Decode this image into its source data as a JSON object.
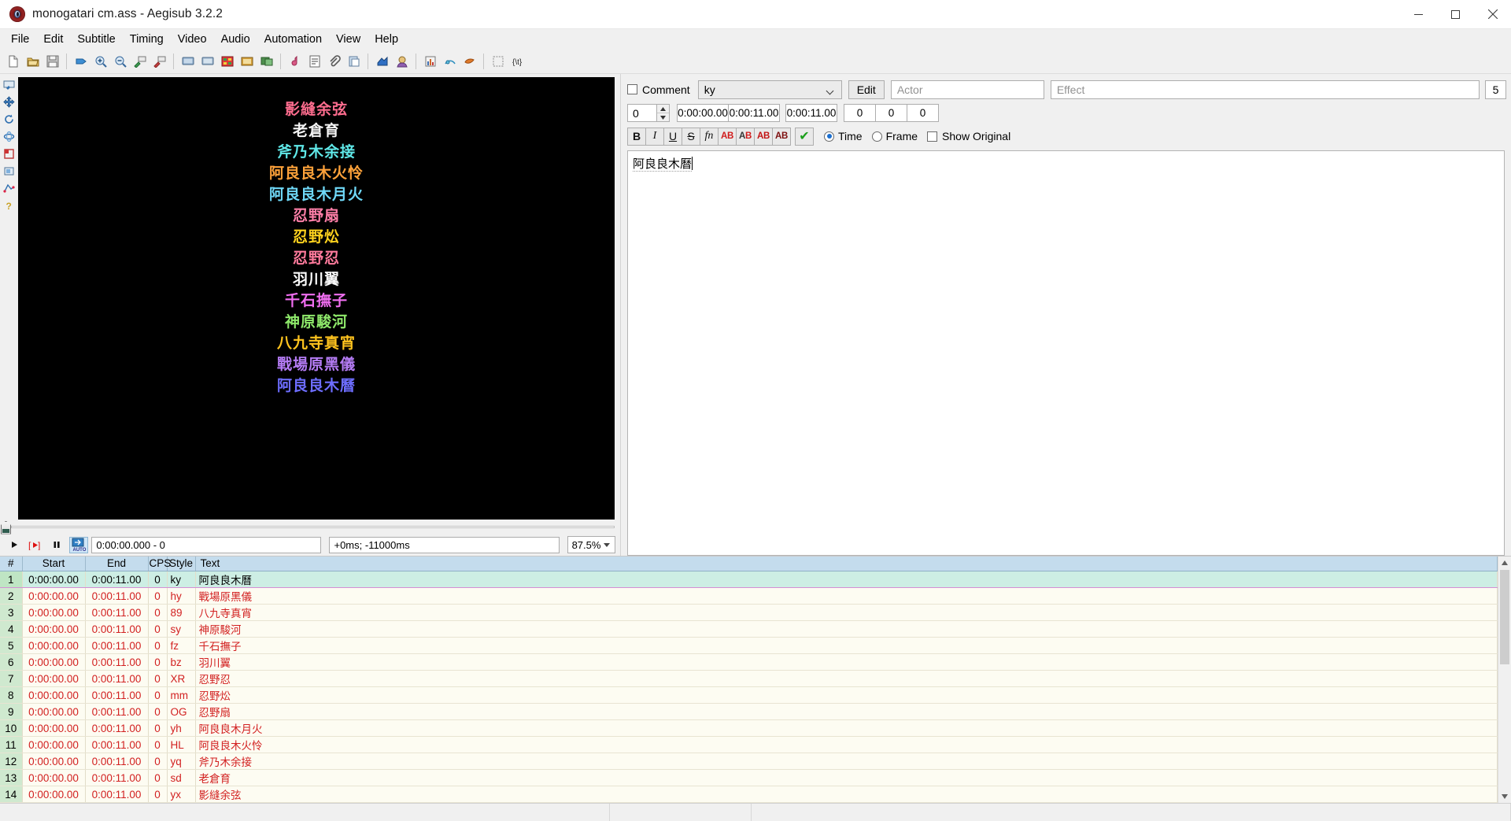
{
  "window": {
    "title": "monogatari cm.ass - Aegisub 3.2.2",
    "app_icon": "aegisub-icon",
    "minimize_label": "Minimize",
    "maximize_label": "Maximize",
    "close_label": "Close"
  },
  "menubar": {
    "items": [
      {
        "label": "File"
      },
      {
        "label": "Edit"
      },
      {
        "label": "Subtitle"
      },
      {
        "label": "Timing"
      },
      {
        "label": "Video"
      },
      {
        "label": "Audio"
      },
      {
        "label": "Automation"
      },
      {
        "label": "View"
      },
      {
        "label": "Help"
      }
    ]
  },
  "toolbar": {
    "groups": [
      [
        "new-subtitles-icon",
        "open-subtitles-icon",
        "save-subtitles-icon"
      ],
      [
        "jump-to-icon",
        "zoom-in-icon",
        "zoom-out-icon",
        "set-start-to-video-icon",
        "set-end-to-video-icon"
      ],
      [
        "open-video-icon",
        "close-video-icon",
        "open-keyframes-icon",
        "open-timecodes-icon",
        "open-video-detached-icon"
      ],
      [
        "open-audio-icon",
        "spellcheck-icon",
        "attachments-icon",
        "paste-over-icon"
      ],
      [
        "shift-times-icon",
        "styles-manager-icon"
      ],
      [
        "properties-icon",
        "resample-icon",
        "fonts-collector-icon"
      ],
      [
        "select-lines-icon",
        "tags-icon"
      ]
    ]
  },
  "video": {
    "tools": [
      "standard-mode-icon",
      "drag-subtitles-icon",
      "rotate-z-icon",
      "rotate-xy-icon",
      "scale-icon",
      "clip-icon",
      "vector-clip-icon",
      "help-icon"
    ],
    "lines": [
      {
        "text": "影縫余弦",
        "color": "#ff6d8f"
      },
      {
        "text": "老倉育",
        "color": "#f4f4f4"
      },
      {
        "text": "斧乃木余接",
        "color": "#5fe8e8"
      },
      {
        "text": "阿良良木火怜",
        "color": "#ffa23a"
      },
      {
        "text": "阿良良木月火",
        "color": "#6fd8f7"
      },
      {
        "text": "忍野扇",
        "color": "#ff7fa8"
      },
      {
        "text": "忍野炂",
        "color": "#ffd21e"
      },
      {
        "text": "忍野忍",
        "color": "#ff7a9c"
      },
      {
        "text": "羽川翼",
        "color": "#fafafa"
      },
      {
        "text": "千石撫子",
        "color": "#f06ef0"
      },
      {
        "text": "神原駿河",
        "color": "#8ee86a"
      },
      {
        "text": "八九寺真宵",
        "color": "#ffc31e"
      },
      {
        "text": "戰場原黑儀",
        "color": "#b57cf5"
      },
      {
        "text": "阿良良木曆",
        "color": "#6d6dff"
      }
    ],
    "playback": {
      "play_label": "play-icon",
      "play_line_label": "play-line-icon",
      "pause_label": "pause-icon",
      "auto_label": "AUTO",
      "position": "0:00:00.000 - 0",
      "offset": "+0ms; -11000ms",
      "zoom": "87.5%"
    }
  },
  "editor": {
    "comment": {
      "label": "Comment",
      "checked": false
    },
    "style": {
      "value": "ky"
    },
    "edit_button": "Edit",
    "actor": {
      "placeholder": "Actor",
      "value": ""
    },
    "effect": {
      "placeholder": "Effect",
      "value": ""
    },
    "layer_right": "5",
    "layer": "0",
    "start_time": "0:00:00.00",
    "end_time": "0:00:11.00",
    "duration": "0:00:11.00",
    "margin_l": "0",
    "margin_r": "0",
    "margin_v": "0",
    "format_buttons": [
      {
        "name": "bold-button",
        "label": "B"
      },
      {
        "name": "italic-button",
        "label": "I"
      },
      {
        "name": "underline-button",
        "label": "U"
      },
      {
        "name": "strikeout-button",
        "label": "S"
      },
      {
        "name": "font-select-button",
        "label": "fn"
      },
      {
        "name": "primary-color-button",
        "label": "AB"
      },
      {
        "name": "secondary-color-button",
        "label": "AB"
      },
      {
        "name": "outline-color-button",
        "label": "AB"
      },
      {
        "name": "shadow-color-button",
        "label": "AB"
      },
      {
        "name": "commit-button",
        "label": "✔"
      }
    ],
    "time_radio": {
      "label": "Time",
      "selected": true
    },
    "frame_radio": {
      "label": "Frame",
      "selected": false
    },
    "show_original": {
      "label": "Show Original",
      "checked": false
    },
    "text_value": "阿良良木曆"
  },
  "grid": {
    "columns": [
      "#",
      "Start",
      "End",
      "CPS",
      "Style",
      "Text"
    ],
    "rows": [
      {
        "num": "1",
        "start": "0:00:00.00",
        "end": "0:00:11.00",
        "cps": "0",
        "style": "ky",
        "text": "阿良良木曆",
        "selected": true
      },
      {
        "num": "2",
        "start": "0:00:00.00",
        "end": "0:00:11.00",
        "cps": "0",
        "style": "hy",
        "text": "戰場原黑儀",
        "selected": false
      },
      {
        "num": "3",
        "start": "0:00:00.00",
        "end": "0:00:11.00",
        "cps": "0",
        "style": "89",
        "text": "八九寺真宵",
        "selected": false
      },
      {
        "num": "4",
        "start": "0:00:00.00",
        "end": "0:00:11.00",
        "cps": "0",
        "style": "sy",
        "text": "神原駿河",
        "selected": false
      },
      {
        "num": "5",
        "start": "0:00:00.00",
        "end": "0:00:11.00",
        "cps": "0",
        "style": "fz",
        "text": "千石撫子",
        "selected": false
      },
      {
        "num": "6",
        "start": "0:00:00.00",
        "end": "0:00:11.00",
        "cps": "0",
        "style": "bz",
        "text": "羽川翼",
        "selected": false
      },
      {
        "num": "7",
        "start": "0:00:00.00",
        "end": "0:00:11.00",
        "cps": "0",
        "style": "XR",
        "text": "忍野忍",
        "selected": false
      },
      {
        "num": "8",
        "start": "0:00:00.00",
        "end": "0:00:11.00",
        "cps": "0",
        "style": "mm",
        "text": "忍野炂",
        "selected": false
      },
      {
        "num": "9",
        "start": "0:00:00.00",
        "end": "0:00:11.00",
        "cps": "0",
        "style": "OG",
        "text": "忍野扇",
        "selected": false
      },
      {
        "num": "10",
        "start": "0:00:00.00",
        "end": "0:00:11.00",
        "cps": "0",
        "style": "yh",
        "text": "阿良良木月火",
        "selected": false
      },
      {
        "num": "11",
        "start": "0:00:00.00",
        "end": "0:00:11.00",
        "cps": "0",
        "style": "HL",
        "text": "阿良良木火怜",
        "selected": false
      },
      {
        "num": "12",
        "start": "0:00:00.00",
        "end": "0:00:11.00",
        "cps": "0",
        "style": "yq",
        "text": "斧乃木余接",
        "selected": false
      },
      {
        "num": "13",
        "start": "0:00:00.00",
        "end": "0:00:11.00",
        "cps": "0",
        "style": "sd",
        "text": "老倉育",
        "selected": false
      },
      {
        "num": "14",
        "start": "0:00:00.00",
        "end": "0:00:11.00",
        "cps": "0",
        "style": "yx",
        "text": "影縫余弦",
        "selected": false
      }
    ]
  },
  "statusbar": {
    "left": "",
    "middle": "",
    "right": ""
  },
  "colors": {
    "selection_green": "#cdeee4",
    "row_cream": "#fdfcf2",
    "header_blue": "#c4dced",
    "text_red": "#d22020"
  }
}
